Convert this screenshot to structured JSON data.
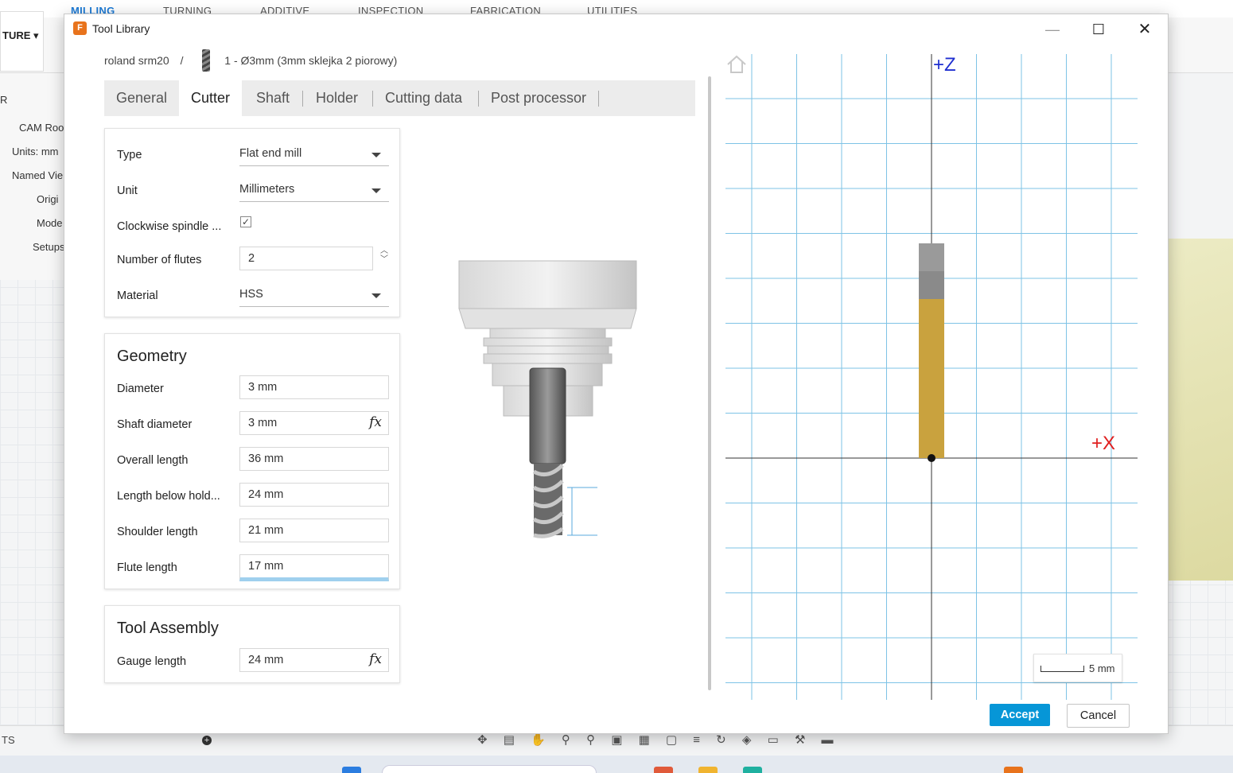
{
  "background": {
    "tabs": [
      "MILLING",
      "TURNING",
      "ADDITIVE",
      "INSPECTION",
      "FABRICATION",
      "UTILITIES"
    ],
    "workspace_button": "TURE",
    "browser_items": [
      "R",
      "CAM Roo",
      "Units: mm",
      "Named Vie",
      "Origi",
      "Mode",
      "Setups"
    ],
    "bottom_label": "TS"
  },
  "dialog": {
    "title": "Tool Library",
    "breadcrumb": {
      "library": "roland srm20",
      "separator": "/",
      "tool": "1 - Ø3mm (3mm sklejka 2 piorowy)"
    },
    "tabs": [
      {
        "label": "General",
        "active": false
      },
      {
        "label": "Cutter",
        "active": true
      },
      {
        "label": "Shaft",
        "active": false
      },
      {
        "label": "Holder",
        "active": false
      },
      {
        "label": "Cutting data",
        "active": false
      },
      {
        "label": "Post processor",
        "active": false
      }
    ],
    "general": {
      "type_label": "Type",
      "type_value": "Flat end mill",
      "unit_label": "Unit",
      "unit_value": "Millimeters",
      "clockwise_label": "Clockwise spindle ...",
      "clockwise_checked": true,
      "flutes_label": "Number of flutes",
      "flutes_value": "2",
      "material_label": "Material",
      "material_value": "HSS"
    },
    "geometry": {
      "title": "Geometry",
      "diameter_label": "Diameter",
      "diameter_value": "3 mm",
      "shaft_diameter_label": "Shaft diameter",
      "shaft_diameter_value": "3 mm",
      "overall_length_label": "Overall length",
      "overall_length_value": "36 mm",
      "length_below_holder_label": "Length below hold...",
      "length_below_holder_value": "24 mm",
      "shoulder_length_label": "Shoulder length",
      "shoulder_length_value": "21 mm",
      "flute_length_label": "Flute length",
      "flute_length_value": "17 mm"
    },
    "assembly": {
      "title": "Tool Assembly",
      "gauge_length_label": "Gauge length",
      "gauge_length_value": "24 mm"
    },
    "fx_label": "fx",
    "viewport": {
      "axis_z": "+Z",
      "axis_x": "+X",
      "scale_label": "5 mm"
    },
    "accept_label": "Accept",
    "cancel_label": "Cancel"
  },
  "colors": {
    "accent": "#0696d7",
    "grid": "#7ec3e6",
    "cutter_gold": "#c9a23e",
    "holder_gray": "#8a8a8a",
    "axis_z": "#1f2fd0",
    "axis_x": "#e02020"
  }
}
